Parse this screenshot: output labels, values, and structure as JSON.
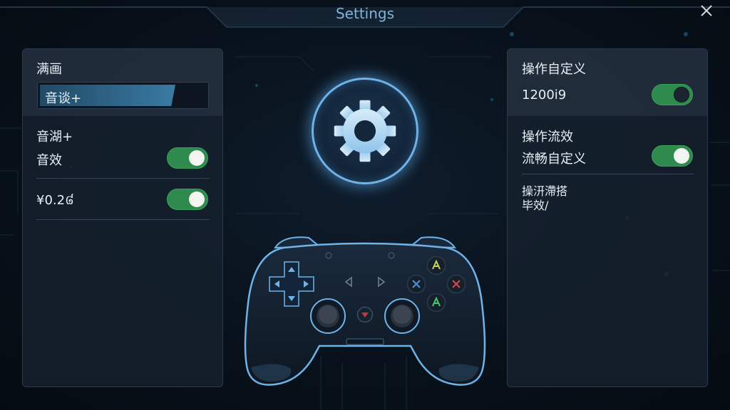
{
  "window": {
    "title": "Settings",
    "close_icon": "close-icon"
  },
  "left_panel": {
    "section_title": "满画",
    "name_field_value": "音谈+",
    "section2_title": "音湖+",
    "row1_label": "音效",
    "row1_toggle_on": true,
    "row2_label": "¥0.2៨",
    "row2_toggle_on": true
  },
  "center": {
    "gear_icon": "gear-icon",
    "controller_icon": "gamepad-icon",
    "buttons": {
      "top": "A",
      "left": "X",
      "right": "X",
      "bottom": "A"
    }
  },
  "right_panel": {
    "section_title": "操作自定义",
    "value_text": "1200i9",
    "value_toggle_on": true,
    "section2_title": "操作流效",
    "row1_label": "流畅自定义",
    "row1_toggle_on": true,
    "note_line1": "操汧滯搭",
    "note_line2": "毕效/"
  },
  "colors": {
    "accent_blue": "#6fb3e8",
    "toggle_green": "#2f8a4e",
    "panel_bg": "#16212e",
    "button_yellow": "#c8d64a",
    "button_blue": "#4a8fd0",
    "button_red": "#d04a4a",
    "button_green": "#4ac870"
  }
}
